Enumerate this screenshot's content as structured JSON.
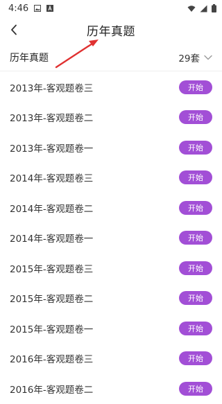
{
  "status_bar": {
    "time": "4:46"
  },
  "nav": {
    "title": "历年真题"
  },
  "filter": {
    "label": "历年真题",
    "count": "29套"
  },
  "items": [
    {
      "title": "2013年-客观题卷三",
      "button": "开始"
    },
    {
      "title": "2013年-客观题卷二",
      "button": "开始"
    },
    {
      "title": "2013年-客观题卷一",
      "button": "开始"
    },
    {
      "title": "2014年-客观题卷三",
      "button": "开始"
    },
    {
      "title": "2014年-客观题卷二",
      "button": "开始"
    },
    {
      "title": "2014年-客观题卷一",
      "button": "开始"
    },
    {
      "title": "2015年-客观题卷三",
      "button": "开始"
    },
    {
      "title": "2015年-客观题卷二",
      "button": "开始"
    },
    {
      "title": "2015年-客观题卷一",
      "button": "开始"
    },
    {
      "title": "2016年-客观题卷三",
      "button": "开始"
    },
    {
      "title": "2016年-客观题卷二",
      "button": "开始"
    }
  ],
  "colors": {
    "accent": "#a24fd6",
    "annotation_arrow": "#e03131"
  },
  "icons": {
    "back": "chevron-left-icon",
    "dropdown": "chevron-down-icon",
    "status_left": [
      "image-icon",
      "text-app-icon"
    ],
    "status_right": [
      "wifi-icon",
      "signal-icon",
      "battery-icon"
    ]
  }
}
